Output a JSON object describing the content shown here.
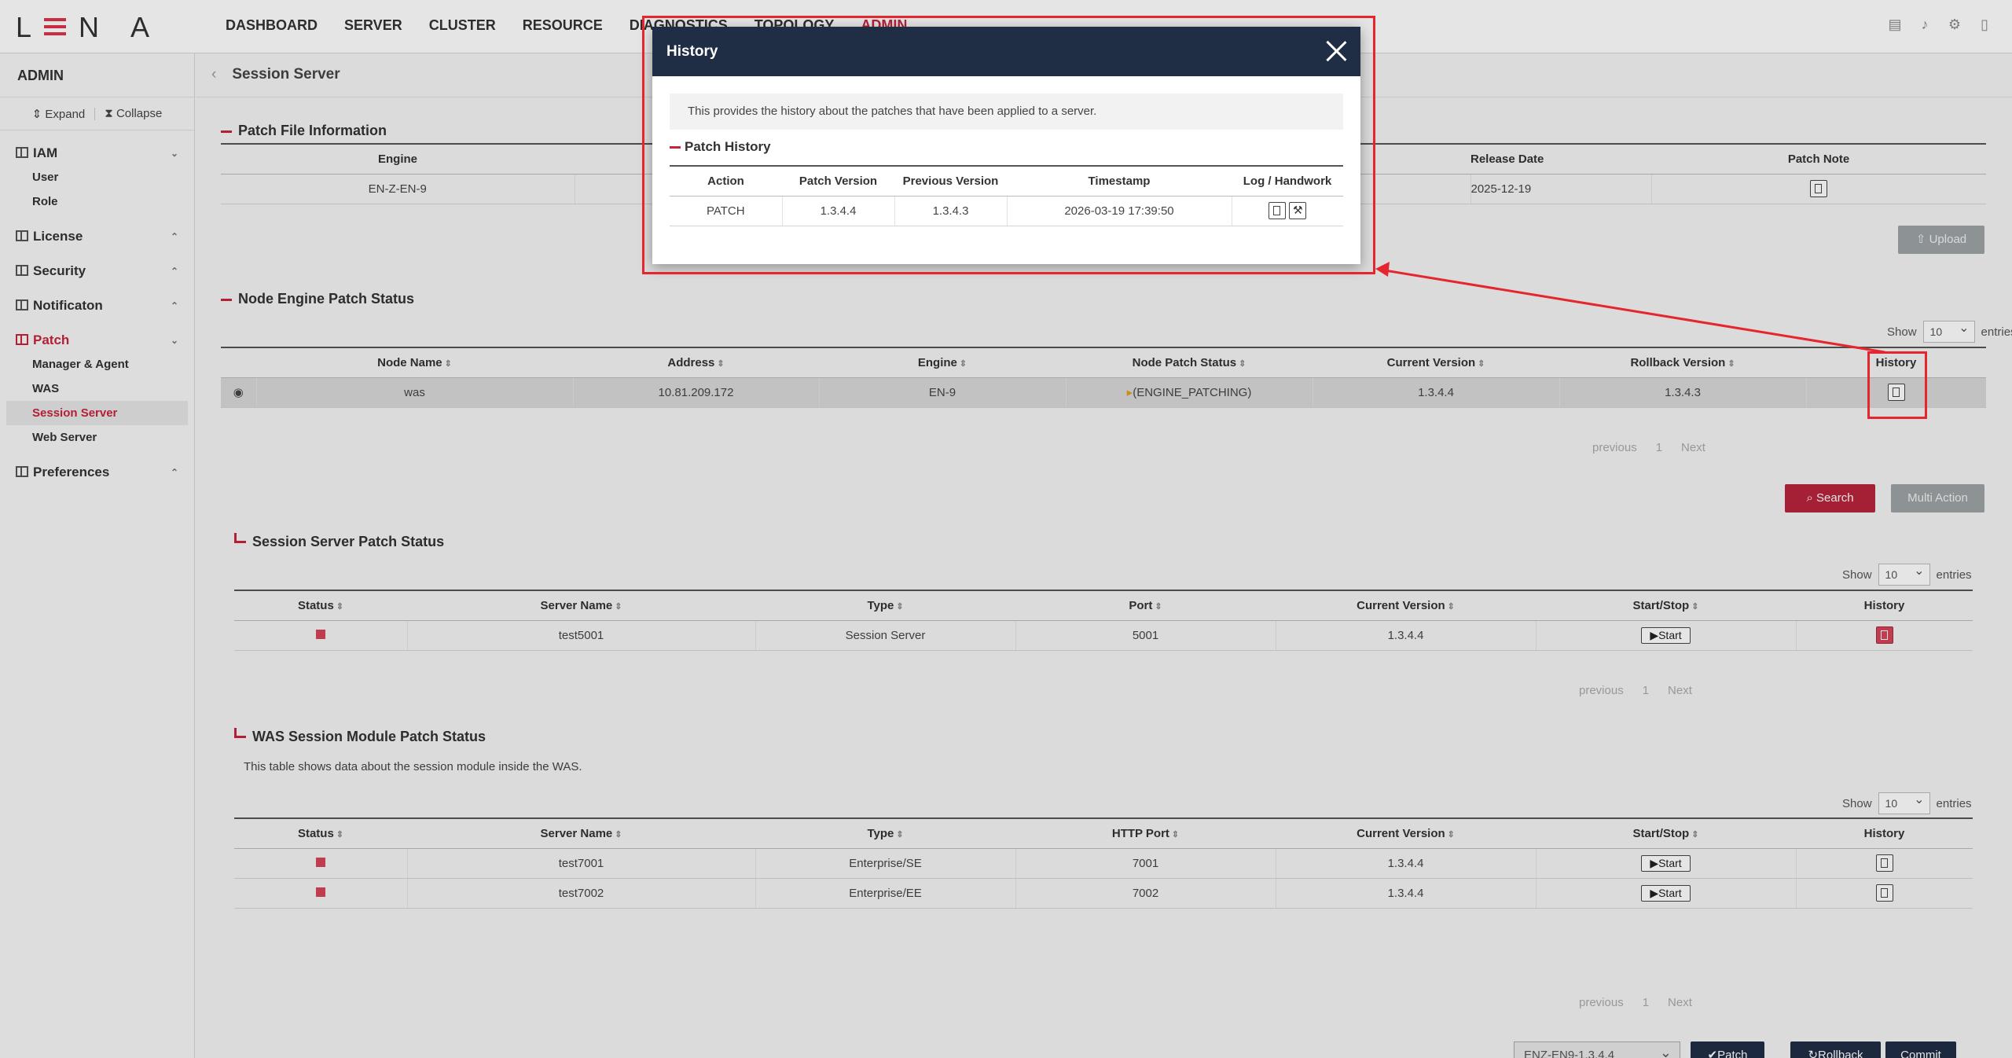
{
  "app": {
    "logo": "L N A",
    "nav": [
      "DASHBOARD",
      "SERVER",
      "CLUSTER",
      "RESOURCE",
      "DIAGNOSTICS",
      "TOPOLOGY",
      "ADMIN"
    ],
    "active_nav": "ADMIN",
    "top_icons": [
      "document-icon",
      "bell-icon",
      "gear-icon",
      "exit-icon"
    ]
  },
  "sidebar": {
    "title": "ADMIN",
    "expand_label": "Expand",
    "collapse_label": "Collapse",
    "groups": [
      {
        "label": "IAM",
        "items": [
          "User",
          "Role"
        ]
      },
      {
        "label": "License",
        "items": []
      },
      {
        "label": "Security",
        "items": []
      },
      {
        "label": "Notificaton",
        "items": []
      },
      {
        "label": "Patch",
        "items": [
          "Manager & Agent",
          "WAS",
          "Session Server",
          "Web Server"
        ]
      },
      {
        "label": "Preferences",
        "items": []
      }
    ],
    "active_item": "Session Server"
  },
  "page": {
    "title": "Session Server",
    "patch_file": {
      "title": "Patch File Information",
      "headers": [
        "Engine",
        "",
        "Release Date",
        "Patch Note"
      ],
      "row": [
        "EN-Z-EN-9",
        "",
        "2025-12-19",
        ""
      ],
      "upload_label": "Upload"
    },
    "node": {
      "title": "Node Engine Patch Status",
      "show": "Show",
      "entries_value": "10",
      "entries": "entries",
      "headers": [
        "",
        "Node Name",
        "Address",
        "Engine",
        "Node Patch Status",
        "Current Version",
        "Rollback Version",
        "History"
      ],
      "row": [
        "",
        "was",
        "10.81.209.172",
        "EN-9",
        "(ENGINE_PATCHING)",
        "1.3.4.4",
        "1.3.4.3",
        ""
      ],
      "pager": [
        "previous",
        "1",
        "Next"
      ],
      "search_label": "Search",
      "multi_label": "Multi Action"
    },
    "session": {
      "title": "Session Server Patch Status",
      "show": "Show",
      "entries_value": "10",
      "entries": "entries",
      "headers": [
        "Status",
        "Server Name",
        "Type",
        "Port",
        "Current Version",
        "Start/Stop",
        "History"
      ],
      "row": [
        "",
        "test5001",
        "Session Server",
        "5001",
        "1.3.4.4",
        "Start",
        ""
      ],
      "pager": [
        "previous",
        "1",
        "Next"
      ]
    },
    "was_module": {
      "title": "WAS Session Module Patch Status",
      "desc": "This table shows data about the session module inside the WAS.",
      "show": "Show",
      "entries_value": "10",
      "entries": "entries",
      "headers": [
        "Status",
        "Server Name",
        "Type",
        "HTTP Port",
        "Current Version",
        "Start/Stop",
        "History"
      ],
      "rows": [
        [
          "",
          "test7001",
          "Enterprise/SE",
          "7001",
          "1.3.4.4",
          "Start",
          ""
        ],
        [
          "",
          "test7002",
          "Enterprise/EE",
          "7002",
          "1.3.4.4",
          "Start",
          ""
        ]
      ],
      "pager": [
        "previous",
        "1",
        "Next"
      ]
    },
    "footer": {
      "select_value": "ENZ-EN9-1.3.4.4",
      "patch_label": "Patch",
      "rollback_label": "Rollback",
      "commit_label": "Commit"
    }
  },
  "modal": {
    "title": "History",
    "info": "This provides the history about the patches that have been applied to a server.",
    "subtitle": "Patch History",
    "headers": [
      "Action",
      "Patch Version",
      "Previous Version",
      "Timestamp",
      "Log / Handwork"
    ],
    "row": [
      "PATCH",
      "1.3.4.4",
      "1.3.4.3",
      "2026-03-19 17:39:50",
      ""
    ]
  },
  "colors": {
    "accent": "#c8243b",
    "navy": "#1f2d45",
    "annotation": "#e5262f"
  }
}
